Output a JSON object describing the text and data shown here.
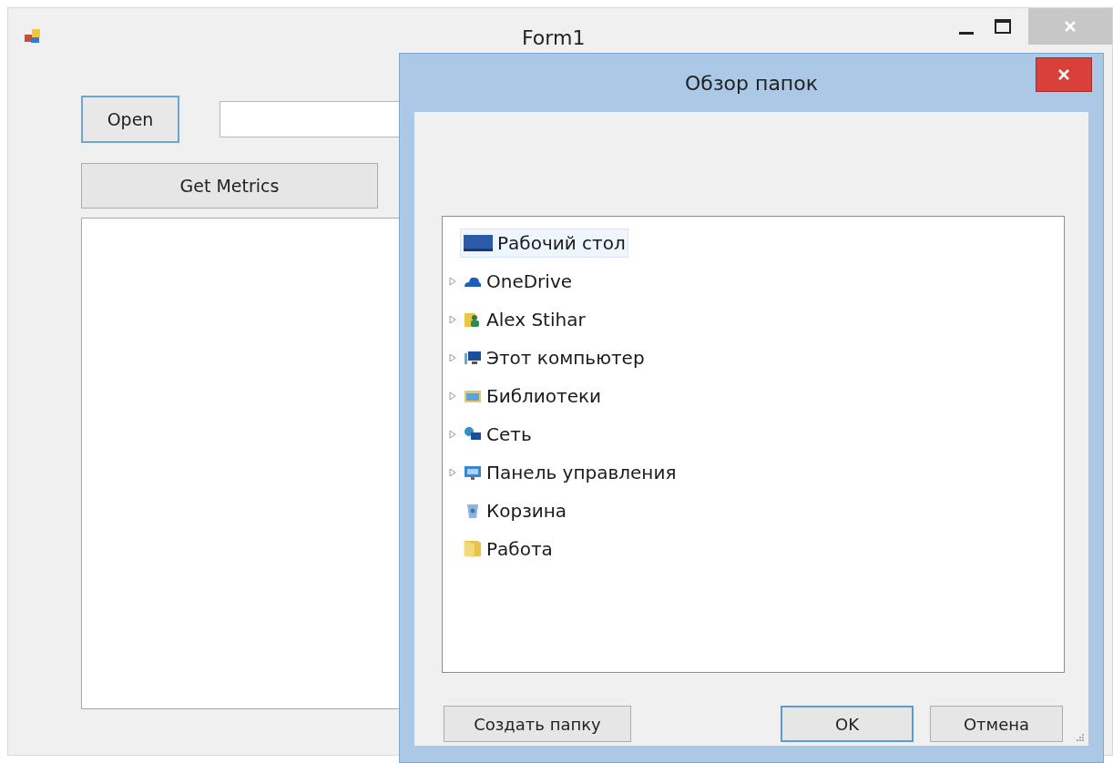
{
  "window": {
    "title": "Form1"
  },
  "form": {
    "open_button": "Open",
    "metrics_button": "Get Metrics"
  },
  "dialog": {
    "title": "Обзор папок",
    "tree": {
      "label": "Рабочий стол",
      "selected": true,
      "children": [
        {
          "label": "OneDrive",
          "expandable": true,
          "selected": false
        },
        {
          "label": "Alex Stihar",
          "expandable": true,
          "selected": false
        },
        {
          "label": "Этот компьютер",
          "expandable": true,
          "selected": false
        },
        {
          "label": "Библиотеки",
          "expandable": true,
          "selected": false
        },
        {
          "label": "Сеть",
          "expandable": true,
          "selected": false
        },
        {
          "label": "Панель управления",
          "expandable": true,
          "selected": false
        },
        {
          "label": "Корзина",
          "expandable": false,
          "selected": false
        },
        {
          "label": "Работа",
          "expandable": false,
          "selected": false
        }
      ]
    },
    "buttons": [
      {
        "label": "Создать папку",
        "default": false
      },
      {
        "label": "OK",
        "default": true
      },
      {
        "label": "Отмена",
        "default": false
      }
    ]
  }
}
